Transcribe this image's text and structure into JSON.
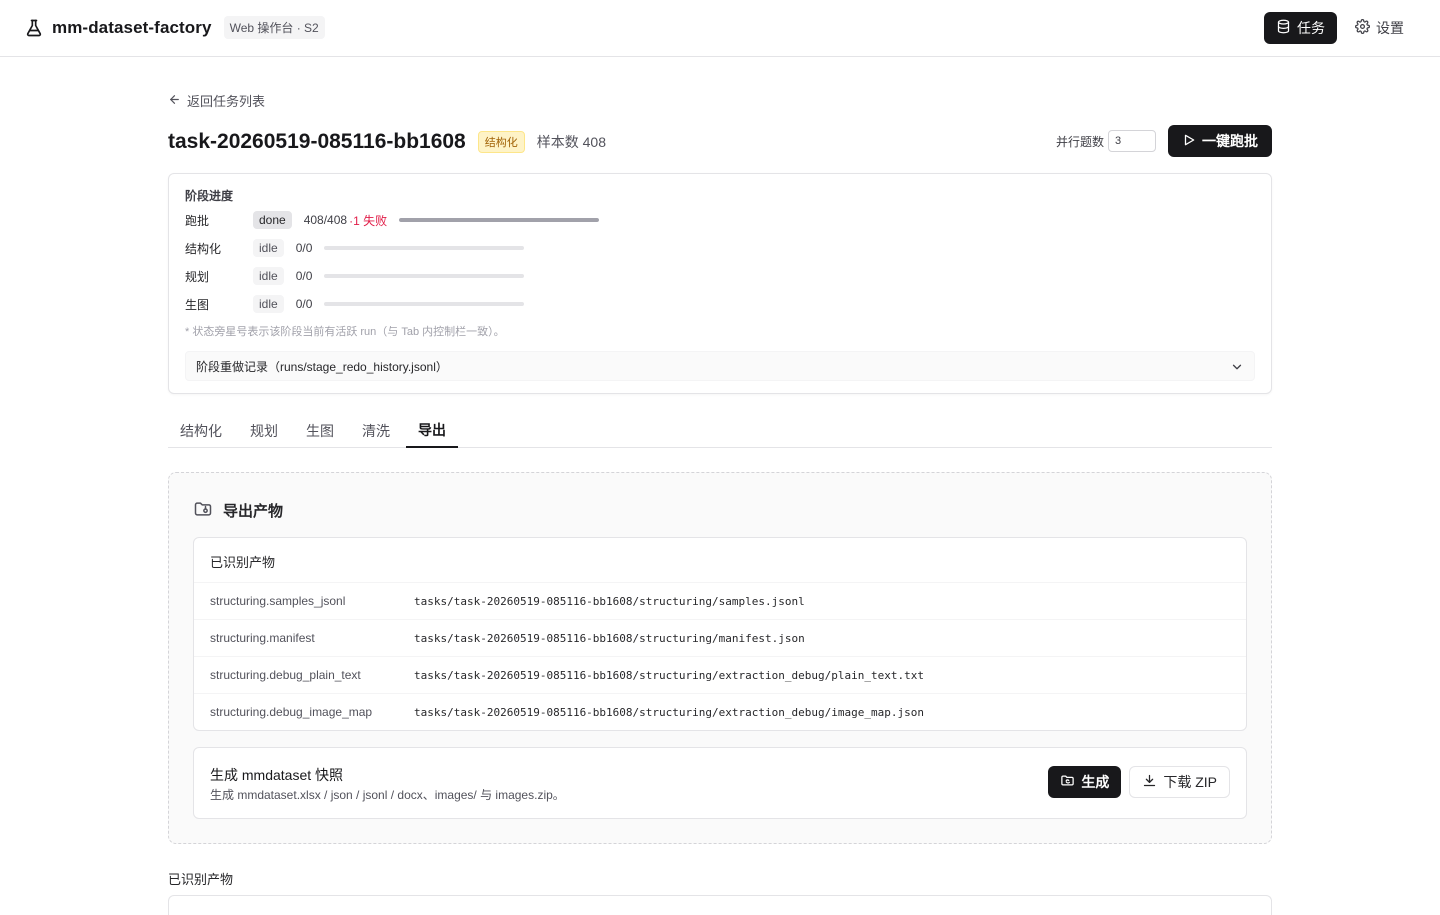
{
  "header": {
    "app_name": "mm-dataset-factory",
    "tag": "Web 操作台 · S2",
    "nav": [
      {
        "label": "任务",
        "icon": "database-icon",
        "active": true
      },
      {
        "label": "设置",
        "icon": "gear-icon",
        "active": false
      }
    ]
  },
  "back_link": "返回任务列表",
  "task": {
    "title": "task-20260519-085116-bb1608",
    "type_badge": "结构化",
    "sample_count": "样本数 408",
    "concurrency_label": "并行题数",
    "concurrency_value": "3",
    "run_button": "一键跑批"
  },
  "stages": {
    "heading": "阶段进度",
    "rows": [
      {
        "name": "跑批",
        "status": "done",
        "progress": "408/408",
        "fail": "·1 失败",
        "fraction": 1.0
      },
      {
        "name": "结构化",
        "status": "idle",
        "progress": "0/0",
        "fail": "",
        "fraction": 0
      },
      {
        "name": "规划",
        "status": "idle",
        "progress": "0/0",
        "fail": "",
        "fraction": 0
      },
      {
        "name": "生图",
        "status": "idle",
        "progress": "0/0",
        "fail": "",
        "fraction": 0
      }
    ],
    "note": "* 状态旁星号表示该阶段当前有活跃 run（与 Tab 内控制栏一致）。",
    "redo_label": "阶段重做记录（runs/stage_redo_history.jsonl）"
  },
  "tabs": [
    {
      "label": "结构化",
      "active": false
    },
    {
      "label": "规划",
      "active": false
    },
    {
      "label": "生图",
      "active": false
    },
    {
      "label": "清洗",
      "active": false
    },
    {
      "label": "导出",
      "active": true
    }
  ],
  "export": {
    "title": "导出产物",
    "artifacts_title": "已识别产物",
    "artifacts": [
      {
        "key": "structuring.samples_jsonl",
        "path": "tasks/task-20260519-085116-bb1608/structuring/samples.jsonl"
      },
      {
        "key": "structuring.manifest",
        "path": "tasks/task-20260519-085116-bb1608/structuring/manifest.json"
      },
      {
        "key": "structuring.debug_plain_text",
        "path": "tasks/task-20260519-085116-bb1608/structuring/extraction_debug/plain_text.txt"
      },
      {
        "key": "structuring.debug_image_map",
        "path": "tasks/task-20260519-085116-bb1608/structuring/extraction_debug/image_map.json"
      }
    ],
    "snapshot_title": "生成 mmdataset 快照",
    "snapshot_desc": "生成 mmdataset.xlsx / json / jsonl / docx、images/ 与 images.zip。",
    "generate_button": "生成",
    "download_button": "下载 ZIP"
  },
  "bottom_label": "已识别产物"
}
